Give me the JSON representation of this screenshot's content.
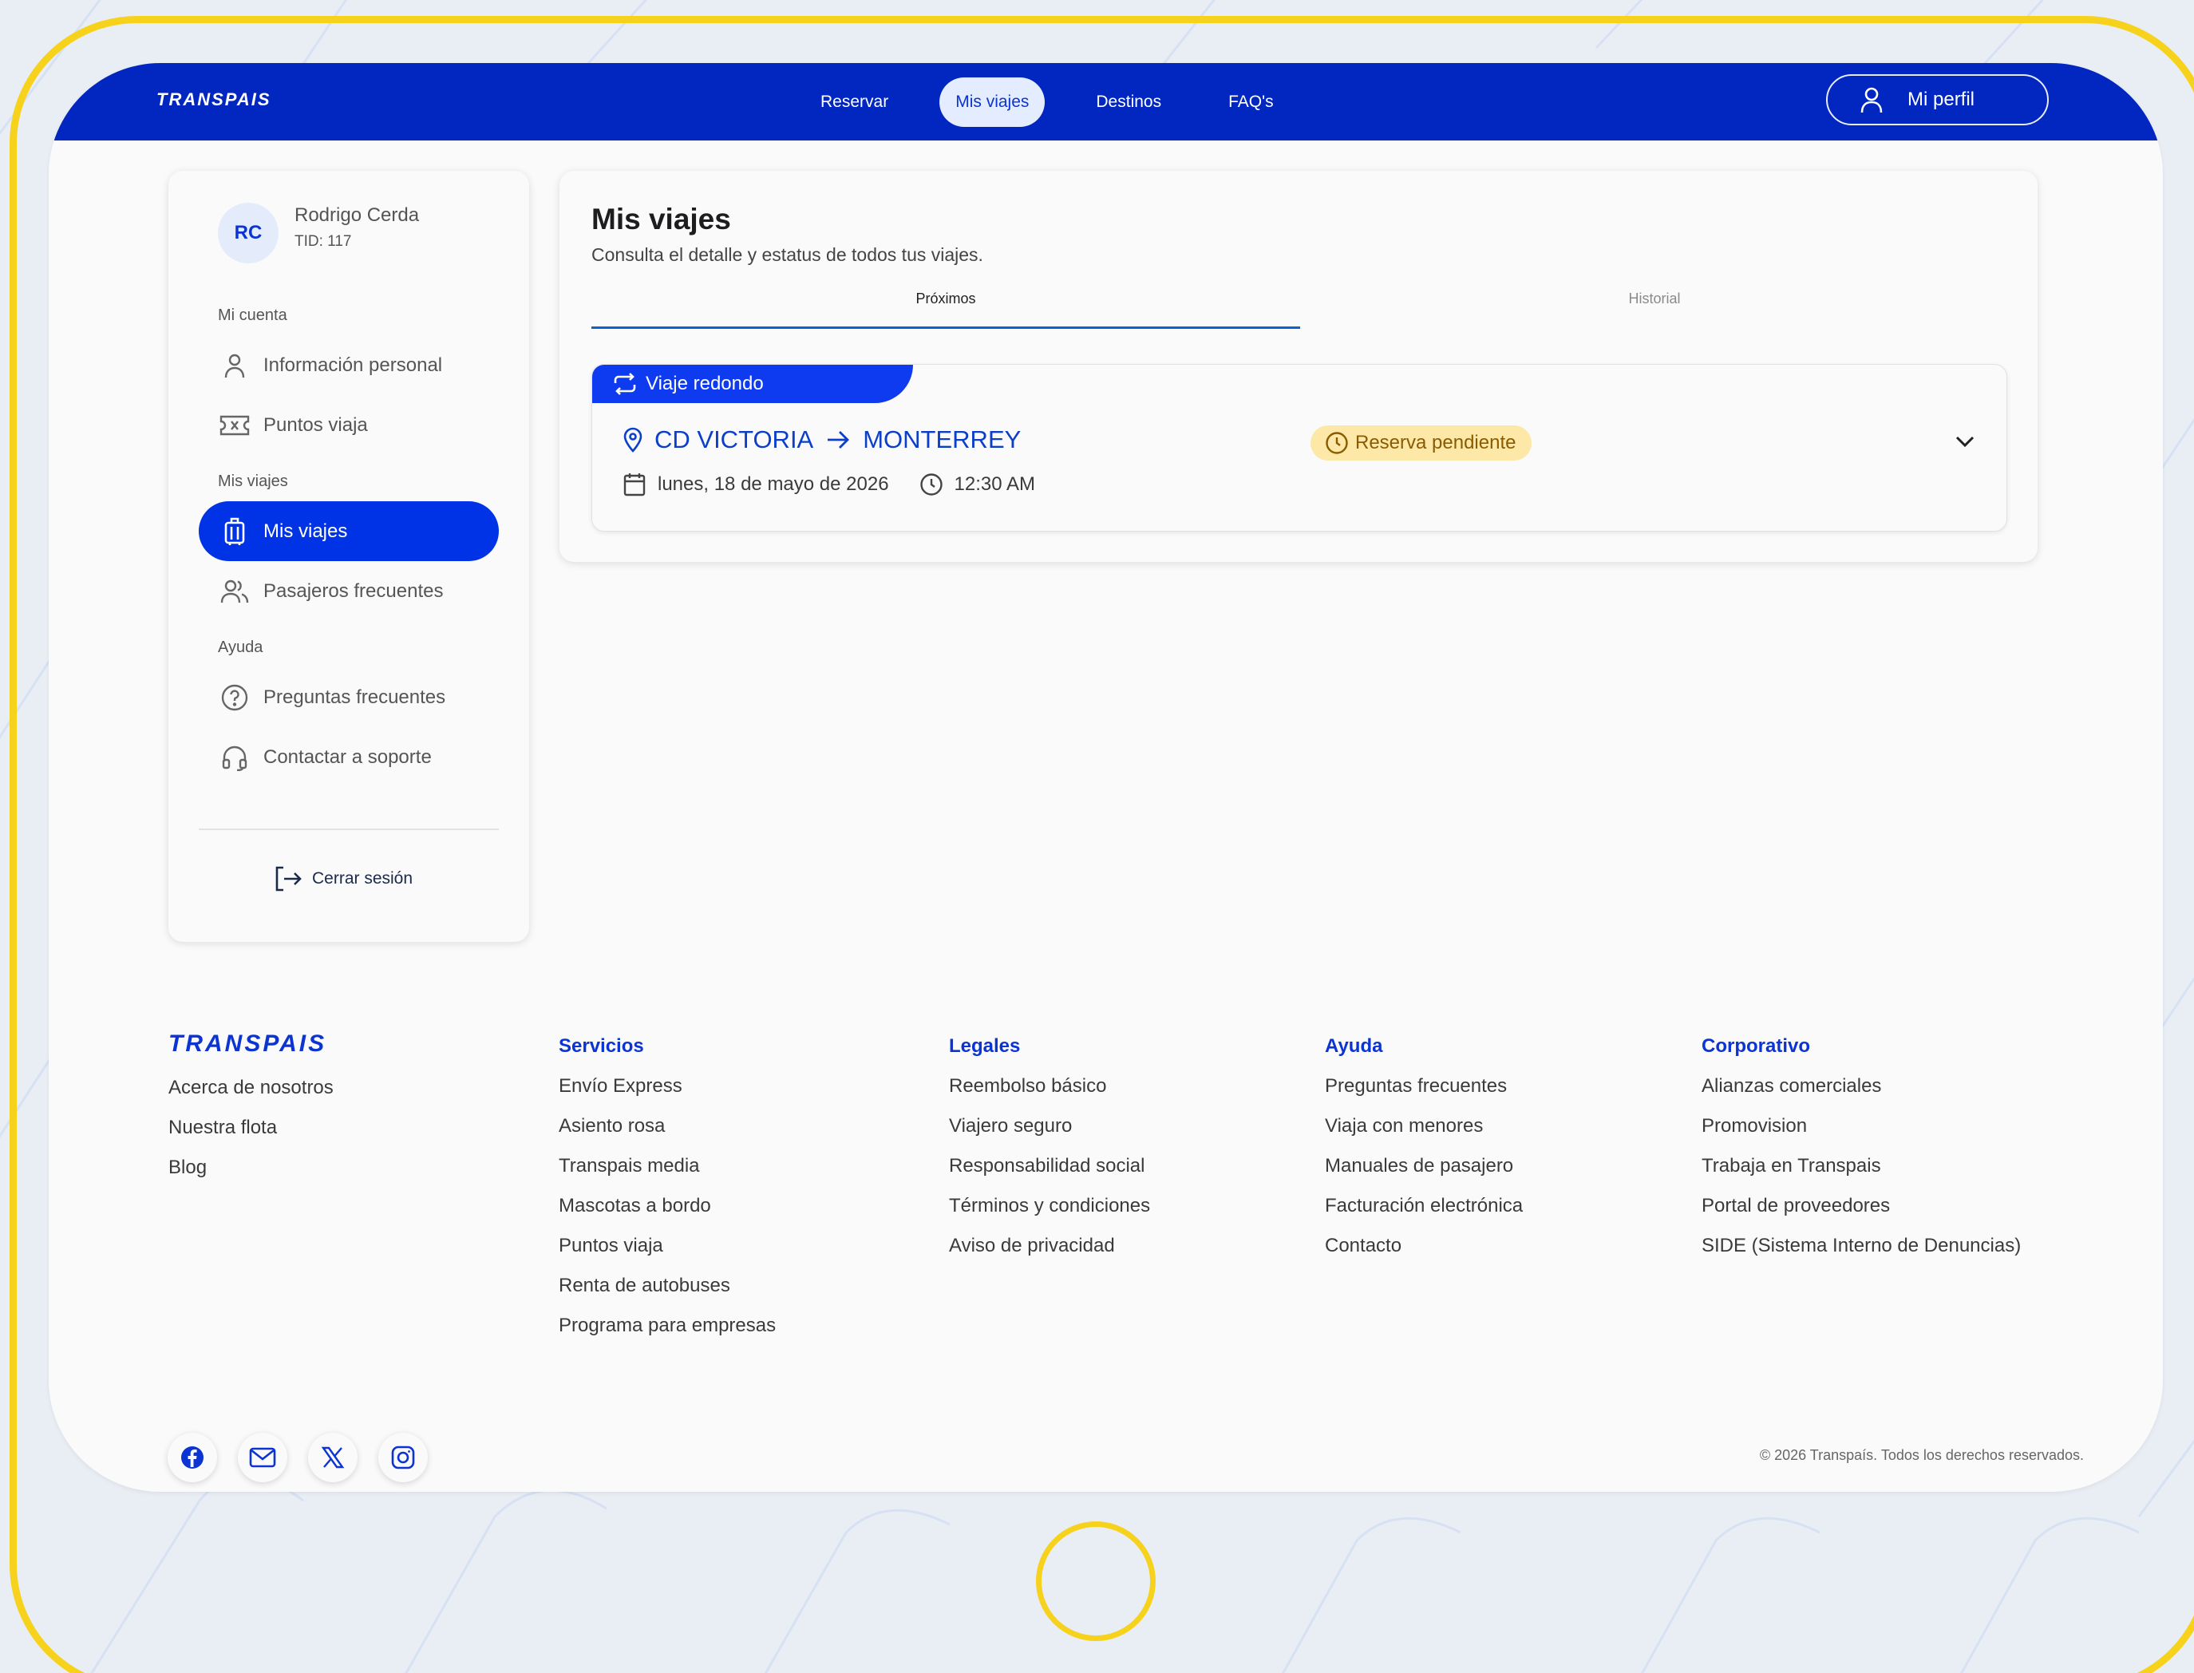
{
  "header": {
    "brand": "TRANSPAIS",
    "nav": [
      "Reservar",
      "Mis viajes",
      "Destinos",
      "FAQ's"
    ],
    "active_nav": "Mis viajes",
    "profile_label": "Mi perfil"
  },
  "sidebar": {
    "avatar_initials": "RC",
    "user_name": "Rodrigo Cerda",
    "user_tid": "TID: 117",
    "section_account": "Mi cuenta",
    "personal_info": "Información personal",
    "points": "Puntos viaja",
    "section_trips": "Mis viajes",
    "my_trips": "Mis viajes",
    "frequent_passengers": "Pasajeros frecuentes",
    "section_help": "Ayuda",
    "faq": "Preguntas frecuentes",
    "support": "Contactar a soporte",
    "logout": "Cerrar sesión"
  },
  "main": {
    "title": "Mis viajes",
    "subtitle": "Consulta el detalle y estatus de todos tus viajes.",
    "tabs": [
      "Próximos",
      "Historial"
    ],
    "trip": {
      "type": "Viaje redondo",
      "origin": "CD VICTORIA",
      "destination": "MONTERREY",
      "status": "Reserva pendiente",
      "date": "lunes, 18 de mayo de 2026",
      "time": "12:30 AM"
    }
  },
  "footer": {
    "brand": "TRANSPAIS",
    "about": [
      "Acerca de nosotros",
      "Nuestra flota",
      "Blog"
    ],
    "servicios": {
      "title": "Servicios",
      "links": [
        "Envío Express",
        "Asiento rosa",
        "Transpais media",
        "Mascotas a bordo",
        "Puntos viaja",
        "Renta de autobuses",
        "Programa para empresas"
      ]
    },
    "legales": {
      "title": "Legales",
      "links": [
        "Reembolso básico",
        "Viajero seguro",
        "Responsabilidad social",
        "Términos y condiciones",
        "Aviso de privacidad"
      ]
    },
    "ayuda": {
      "title": "Ayuda",
      "links": [
        "Preguntas frecuentes",
        "Viaja con menores",
        "Manuales de pasajero",
        "Facturación electrónica",
        "Contacto"
      ]
    },
    "corporativo": {
      "title": "Corporativo",
      "links": [
        "Alianzas comerciales",
        "Promovision",
        "Trabaja en Transpais",
        "Portal de proveedores",
        "SIDE (Sistema Interno de Denuncias)"
      ]
    },
    "social_icons": [
      "facebook-icon",
      "mail-icon",
      "x-icon",
      "instagram-icon"
    ],
    "copyright": "© 2026 Transpaís. Todos los derechos reservados."
  },
  "colors": {
    "primary": "#0226c0",
    "accent": "#0033e6",
    "frame": "#f7d21c",
    "status_bg": "#fde8a8",
    "status_text": "#8a5b00"
  }
}
